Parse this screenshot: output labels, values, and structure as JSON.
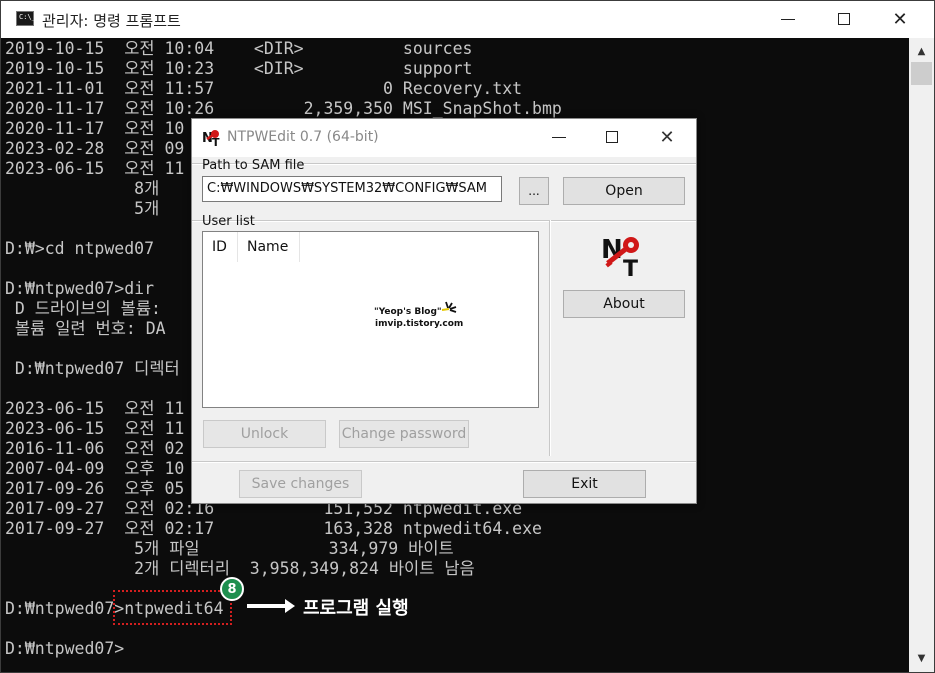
{
  "cmd": {
    "title": "관리자: 명령 프롬프트",
    "lines": [
      "2019-10-15  오전 10:04    <DIR>          sources",
      "2019-10-15  오전 10:23    <DIR>          support",
      "2021-11-01  오전 11:57                 0 Recovery.txt",
      "2020-11-17  오전 10:26         2,359,350 MSI_SnapShot.bmp",
      "2020-11-17  오전 10",
      "2023-02-28  오전 09",
      "2023-06-15  오전 11",
      "             8개",
      "             5개",
      "",
      "D:₩>cd ntpwed07",
      "",
      "D:₩ntpwed07>dir",
      " D 드라이브의 볼륨:",
      " 볼륨 일련 번호: DA",
      "",
      " D:₩ntpwed07 디렉터",
      "",
      "2023-06-15  오전 11",
      "2023-06-15  오전 11",
      "2016-11-06  오전 02",
      "2007-04-09  오후 10",
      "2017-09-26  오후 05",
      "2017-09-27  오전 02:16           151,552 ntpwedit.exe",
      "2017-09-27  오전 02:17           163,328 ntpwedit64.exe",
      "             5개 파일             334,979 바이트",
      "             2개 디렉터리  3,958,349,824 바이트 남음",
      "",
      "D:₩ntpwed07>ntpwedit64",
      "",
      "D:₩ntpwed07>"
    ]
  },
  "annotation": {
    "step_number": "8",
    "text": "프로그램 실행",
    "color": "#d31f1f",
    "badge_color": "#1e8f4f"
  },
  "dialog": {
    "title": "NTPWEdit 0.7 (64-bit)",
    "path_label": "Path to SAM file",
    "path_value": "C:₩WINDOWS₩SYSTEM32₩CONFIG₩SAM",
    "browse_label": "...",
    "open_label": "Open",
    "user_list_label": "User list",
    "columns": [
      "ID",
      "Name"
    ],
    "about_label": "About",
    "unlock_label": "Unlock",
    "change_password_label": "Change password",
    "save_changes_label": "Save changes",
    "exit_label": "Exit",
    "watermark_line1": "\"Yeop's Blog\"",
    "watermark_line2": "imvip.tistory.com",
    "logo_letters": "NT",
    "logo_color": "#d01818"
  }
}
